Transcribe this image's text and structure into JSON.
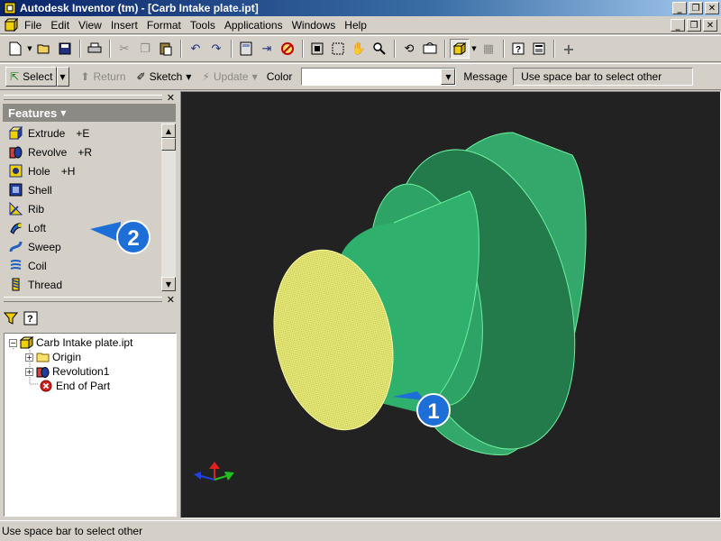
{
  "window": {
    "title": "Autodesk Inventor (tm) - [Carb Intake plate.ipt]",
    "controls": [
      "_",
      "❐",
      "✕"
    ]
  },
  "menu": {
    "items": [
      "File",
      "Edit",
      "View",
      "Insert",
      "Format",
      "Tools",
      "Applications",
      "Windows",
      "Help"
    ],
    "doc_controls": [
      "_",
      "❐",
      "✕"
    ]
  },
  "toolbar2": {
    "select_label": "Select",
    "return_label": "Return",
    "sketch_label": "Sketch",
    "update_label": "Update",
    "color_label": "Color",
    "color_value": "",
    "message_label": "Message",
    "message_value": "Use space bar to select other"
  },
  "panel": {
    "header": "Features",
    "items": [
      {
        "label": "Extrude",
        "shortcut": "+E",
        "icon": "extrude-icon"
      },
      {
        "label": "Revolve",
        "shortcut": "+R",
        "icon": "revolve-icon"
      },
      {
        "label": "Hole",
        "shortcut": "+H",
        "icon": "hole-icon"
      },
      {
        "label": "Shell",
        "shortcut": "",
        "icon": "shell-icon"
      },
      {
        "label": "Rib",
        "shortcut": "",
        "icon": "rib-icon"
      },
      {
        "label": "Loft",
        "shortcut": "",
        "icon": "loft-icon"
      },
      {
        "label": "Sweep",
        "shortcut": "",
        "icon": "sweep-icon"
      },
      {
        "label": "Coil",
        "shortcut": "",
        "icon": "coil-icon"
      },
      {
        "label": "Thread",
        "shortcut": "",
        "icon": "thread-icon"
      }
    ]
  },
  "browser": {
    "nodes": [
      {
        "label": "Carb Intake plate.ipt"
      },
      {
        "label": "Origin"
      },
      {
        "label": "Revolution1"
      },
      {
        "label": "End of Part"
      }
    ]
  },
  "callouts": [
    "1",
    "2"
  ],
  "colors": {
    "viewport_bg": "#222222",
    "part_green": "#3cc07a",
    "face_yellow": "#e8ea78",
    "callout_blue": "#1e6ed8"
  },
  "status": {
    "text": "Use space bar to select other"
  }
}
